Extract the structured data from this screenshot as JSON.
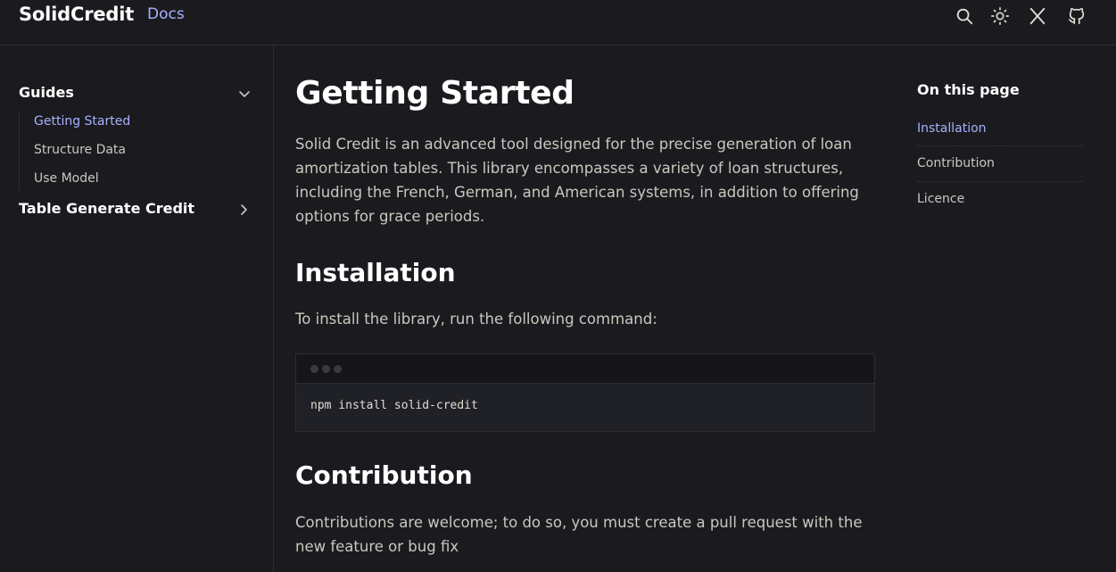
{
  "header": {
    "brand": "SolidCredit",
    "nav_docs": "Docs",
    "icons": [
      "search-icon",
      "sun-icon",
      "x-logo-icon",
      "github-icon"
    ]
  },
  "sidebar": {
    "groups": [
      {
        "title": "Guides",
        "expanded": true,
        "items": [
          {
            "label": "Getting Started",
            "active": true
          },
          {
            "label": "Structure Data",
            "active": false
          },
          {
            "label": "Use Model",
            "active": false
          }
        ]
      },
      {
        "title": "Table Generate Credit",
        "expanded": false,
        "items": []
      }
    ]
  },
  "main": {
    "title": "Getting Started",
    "intro": "Solid Credit is an advanced tool designed for the precise generation of loan amortization tables. This library encompasses a variety of loan structures, including the French, German, and American systems, in addition to offering options for grace periods.",
    "installation": {
      "heading": "Installation",
      "text": "To install the library, run the following command:",
      "code": "npm install solid-credit"
    },
    "contribution": {
      "heading": "Contribution",
      "text": "Contributions are welcome; to do so, you must create a pull request with the new feature or bug fix"
    }
  },
  "toc": {
    "title": "On this page",
    "items": [
      {
        "label": "Installation",
        "active": true
      },
      {
        "label": "Contribution",
        "active": false
      },
      {
        "label": "Licence",
        "active": false
      }
    ]
  },
  "colors": {
    "background": "#1b1b1f",
    "accent": "#a8b1ff",
    "text": "#dfdfd6",
    "border": "#2e2e32"
  }
}
